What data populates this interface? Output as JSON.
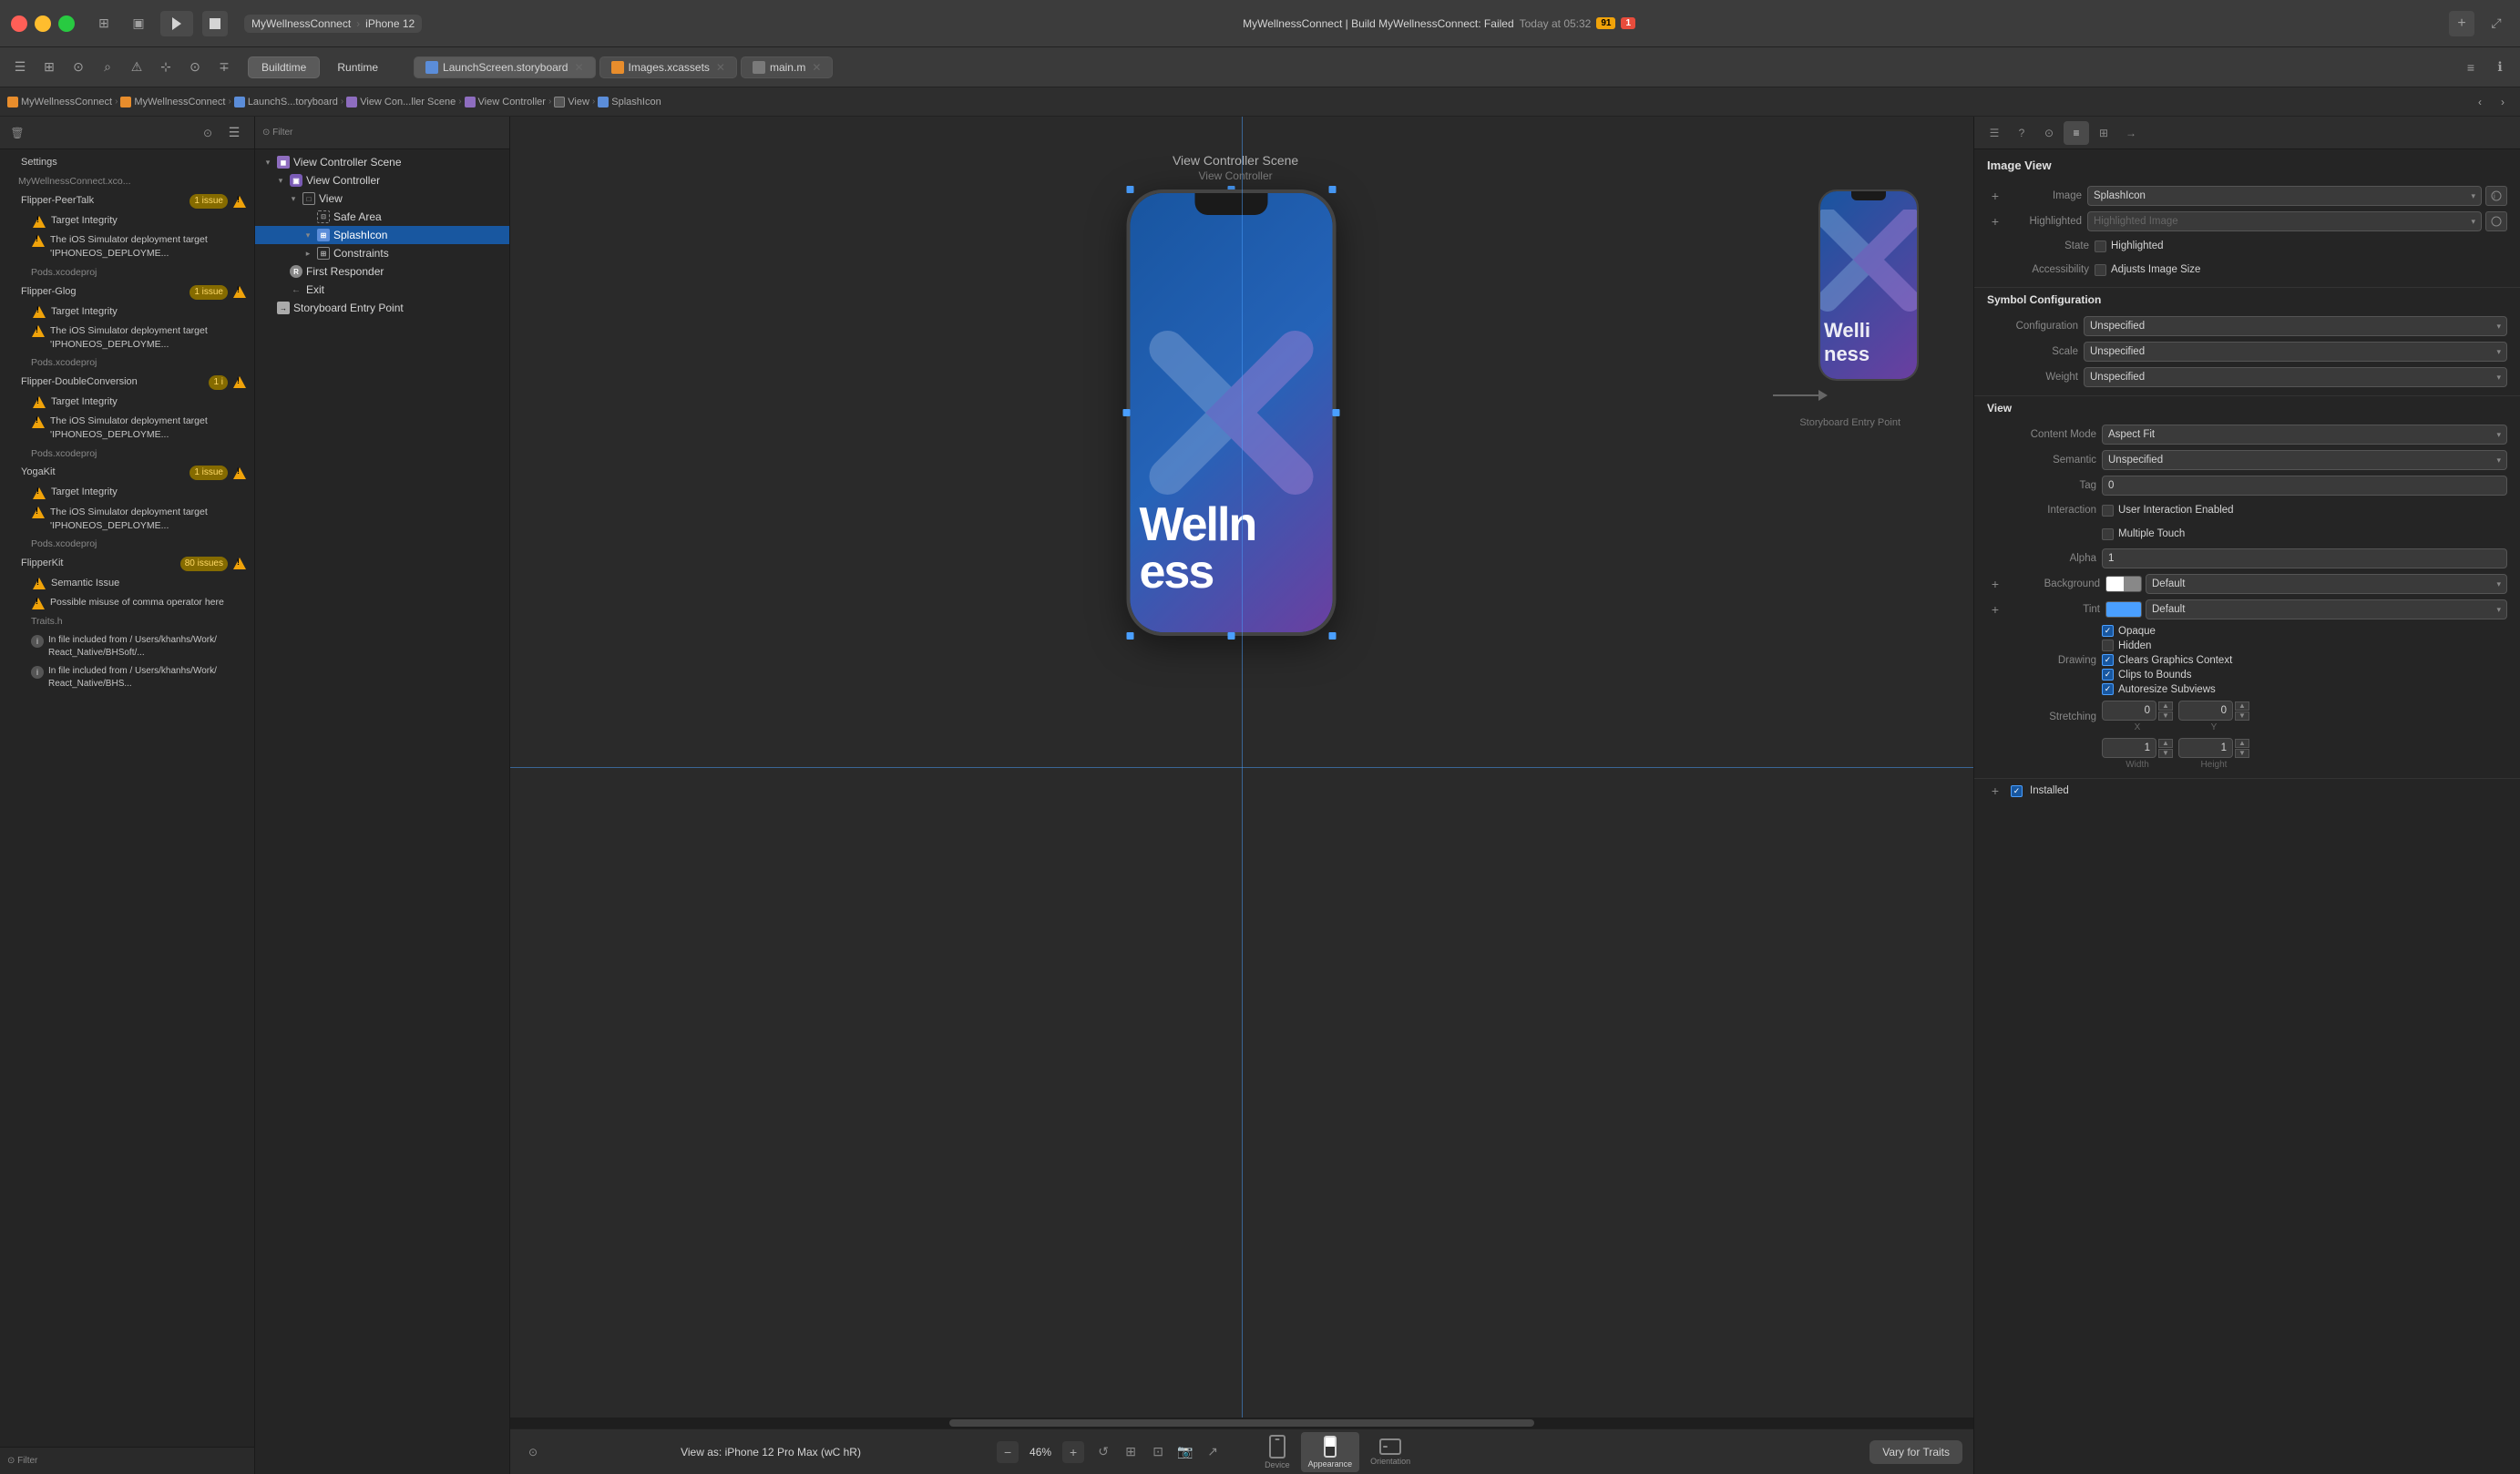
{
  "app": {
    "title": "MyWellnessConnect",
    "build_target": "iPhone 12",
    "build_status": "MyWellnessConnect | Build MyWellnessConnect: Failed",
    "build_time": "Today at 05:32",
    "warning_count": "91",
    "error_count": "1"
  },
  "tabs": {
    "buildtime": "Buildtime",
    "runtime": "Runtime"
  },
  "files": {
    "storyboard": "LaunchScreen.storyboard",
    "xcassets": "Images.xcassets",
    "main_m": "main.m"
  },
  "breadcrumb": {
    "project": "MyWellnessConnect",
    "folder": "MyWellnessConnect",
    "storyboard": "LaunchS...toryboard",
    "scene": "View Con...ller Scene",
    "vc": "View Controller",
    "view": "View",
    "image": "SplashIcon"
  },
  "navigator": {
    "items": [
      {
        "label": "View Controller Scene",
        "indent": 0,
        "type": "scene",
        "disclosure": "open"
      },
      {
        "label": "View Controller",
        "indent": 1,
        "type": "vc",
        "disclosure": "open"
      },
      {
        "label": "View",
        "indent": 2,
        "type": "view",
        "disclosure": "open"
      },
      {
        "label": "Safe Area",
        "indent": 3,
        "type": "safearea",
        "disclosure": "none"
      },
      {
        "label": "SplashIcon",
        "indent": 3,
        "type": "image",
        "disclosure": "open",
        "selected": true
      },
      {
        "label": "Constraints",
        "indent": 3,
        "type": "constraints",
        "disclosure": "closed"
      },
      {
        "label": "First Responder",
        "indent": 1,
        "type": "responder",
        "disclosure": "none"
      },
      {
        "label": "Exit",
        "indent": 1,
        "type": "exit",
        "disclosure": "none"
      },
      {
        "label": "Storyboard Entry Point",
        "indent": 0,
        "type": "ep",
        "disclosure": "none"
      }
    ]
  },
  "canvas": {
    "scene_title": "View Controller Scene",
    "scene_subtitle": "View Controller",
    "entry_point_label": "Storyboard Entry Point",
    "zoom_percent": "46%",
    "view_as_label": "View as: iPhone 12 Pro Max (wC hR)"
  },
  "inspector": {
    "title": "Image View",
    "sections": {
      "image": {
        "image_label": "Image",
        "image_value": "SplashIcon",
        "highlighted_label": "Highlighted",
        "highlighted_value": "Highlighted Image",
        "state_label": "State",
        "state_value": "Highlighted",
        "accessibility_label": "Accessibility",
        "accessibility_value": "Adjusts Image Size"
      },
      "symbol": {
        "title": "Symbol Configuration",
        "config_label": "Configuration",
        "config_value": "Unspecified",
        "scale_label": "Scale",
        "scale_value": "Unspecified",
        "weight_label": "Weight",
        "weight_value": "Unspecified"
      },
      "view": {
        "title": "View",
        "content_mode_label": "Content Mode",
        "content_mode_value": "Aspect Fit",
        "semantic_label": "Semantic",
        "semantic_value": "Unspecified",
        "tag_label": "Tag",
        "tag_value": "0",
        "interaction_label": "Interaction",
        "uie_label": "User Interaction Enabled",
        "mt_label": "Multiple Touch",
        "alpha_label": "Alpha",
        "alpha_value": "1",
        "background_label": "Background",
        "background_value": "Default",
        "tint_label": "Tint",
        "tint_value": "Default",
        "drawing_label": "Drawing",
        "opaque_label": "Opaque",
        "hidden_label": "Hidden",
        "clears_label": "Clears Graphics Context",
        "clips_label": "Clips to Bounds",
        "autoresize_label": "Autoresize Subviews",
        "stretching_label": "Stretching",
        "stretching_x": "0",
        "stretching_y": "0",
        "x_label": "X",
        "y_label": "Y",
        "width_label": "Width",
        "height_label": "Height",
        "width_value": "1",
        "height_value": "1"
      }
    }
  },
  "issues": [
    {
      "label": "Settings",
      "indent": 0,
      "type": "group"
    },
    {
      "label": "MyWellnessConnect.xco...",
      "indent": 1,
      "type": "file"
    },
    {
      "label": "Flipper-PeerTalk",
      "badge": "1 issue",
      "badge_type": "warn",
      "indent": 0,
      "type": "group",
      "has_warn": true
    },
    {
      "label": "Target Integrity",
      "indent": 1,
      "type": "subgroup",
      "has_warn": true
    },
    {
      "label": "The iOS Simulator deployment target 'IPHONEOS_DEPLOYME...",
      "indent": 2,
      "type": "warn"
    },
    {
      "label": "Pods.xcodeproj",
      "indent": 2,
      "type": "file"
    },
    {
      "label": "Flipper-Glog",
      "badge": "1 issue",
      "badge_type": "warn",
      "indent": 0,
      "type": "group",
      "has_warn": true
    },
    {
      "label": "Target Integrity",
      "indent": 1,
      "type": "subgroup",
      "has_warn": true
    },
    {
      "label": "The iOS Simulator deployment target 'IPHONEOS_DEPLOYME...",
      "indent": 2,
      "type": "warn"
    },
    {
      "label": "Pods.xcodeproj",
      "indent": 2,
      "type": "file"
    },
    {
      "label": "Flipper-DoubleConversion",
      "badge": "1 i",
      "badge_type": "warn",
      "indent": 0,
      "type": "group",
      "has_warn": true
    },
    {
      "label": "Target Integrity",
      "indent": 1,
      "type": "subgroup",
      "has_warn": true
    },
    {
      "label": "The iOS Simulator deployment target 'IPHONEOS_DEPLOYME...",
      "indent": 2,
      "type": "warn"
    },
    {
      "label": "Pods.xcodeproj",
      "indent": 2,
      "type": "file"
    },
    {
      "label": "YogaKit",
      "badge": "1 issue",
      "badge_type": "warn",
      "indent": 0,
      "type": "group",
      "has_warn": true
    },
    {
      "label": "Target Integrity",
      "indent": 1,
      "type": "subgroup",
      "has_warn": true
    },
    {
      "label": "The iOS Simulator deployment target 'IPHONEOS_DEPLOYME...",
      "indent": 2,
      "type": "warn"
    },
    {
      "label": "Pods.xcodeproj",
      "indent": 2,
      "type": "file"
    },
    {
      "label": "FlipperKit",
      "badge": "80 issues",
      "badge_type": "warn",
      "indent": 0,
      "type": "group",
      "has_warn": true
    },
    {
      "label": "Semantic Issue",
      "indent": 1,
      "type": "subgroup",
      "has_warn": true
    },
    {
      "label": "Possible misuse of comma operator here",
      "indent": 2,
      "type": "warn"
    },
    {
      "label": "Traits.h",
      "indent": 2,
      "type": "file"
    },
    {
      "label": "In file included from / Users/khanhs/Work/ React_Native/BHSoft/...",
      "indent": 2,
      "type": "info"
    },
    {
      "label": "In file included from / Users/khanhs/Work/ React_Native/BHS...",
      "indent": 2,
      "type": "info"
    }
  ],
  "bottom_bar": {
    "view_as": "View as: iPhone 12 Pro Max (wC hR)",
    "zoom": "46%",
    "vary_traits": "Vary for Traits",
    "device_label": "Device",
    "appearance_label": "Appearance",
    "orientation_label": "Orientation"
  },
  "installed_label": "Installed"
}
